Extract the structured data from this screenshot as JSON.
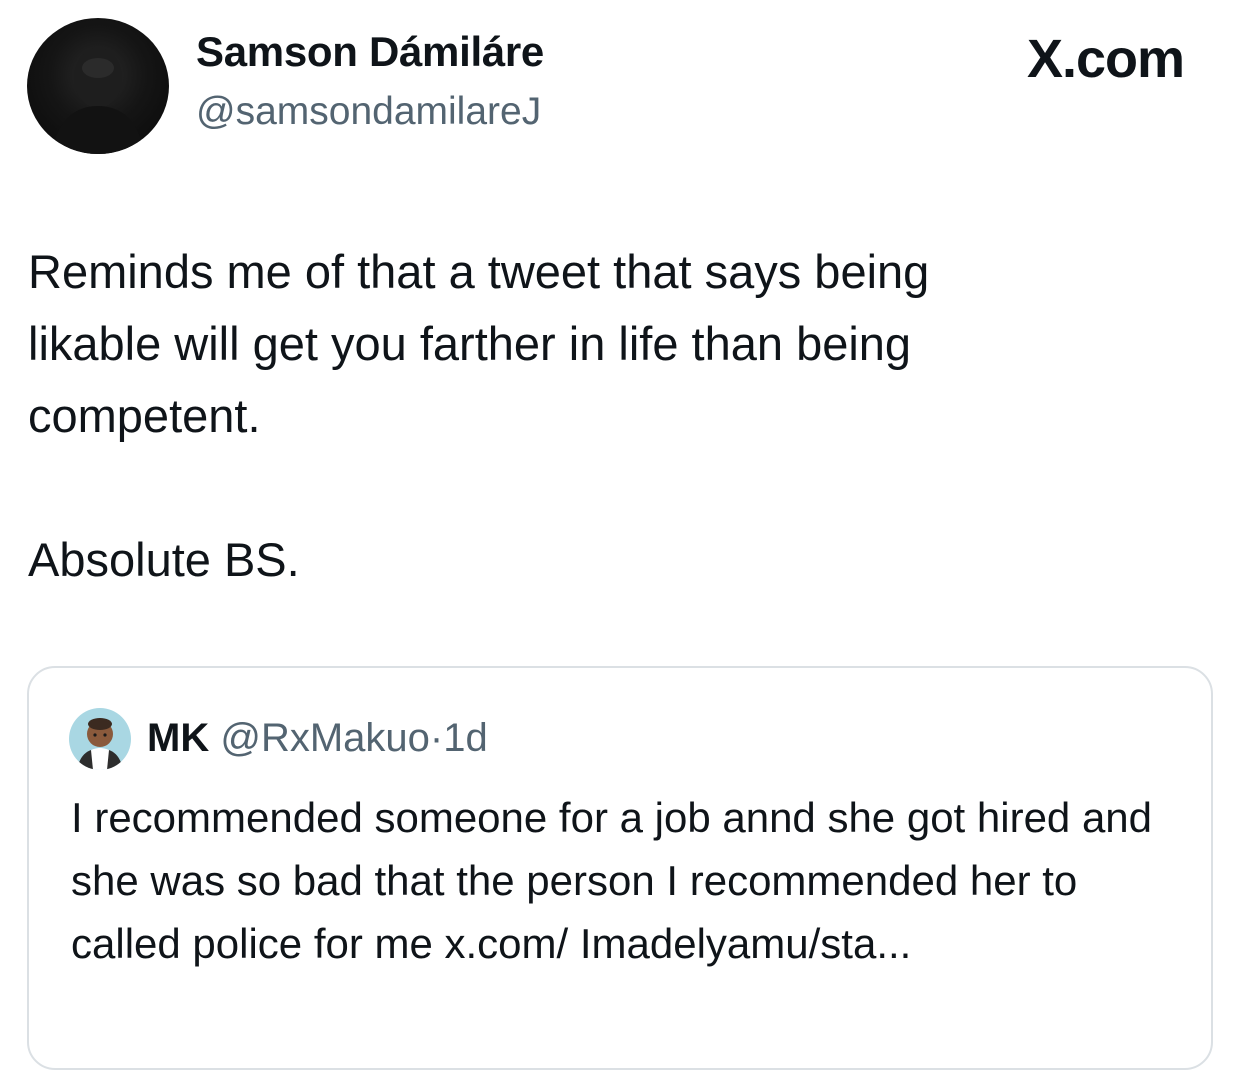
{
  "author": {
    "name": "Samson Dámiláre",
    "handle": "@samsondamilareJ"
  },
  "brand": "X.com",
  "tweet": {
    "text": "Reminds me of that a tweet that says being\nlikable will get you farther in life than being\ncompetent.\n\nAbsolute BS."
  },
  "quote": {
    "name": "MK",
    "handle": "@RxMakuo",
    "separator": "·",
    "time": "1d",
    "text": "I recommended someone for a job annd she got hired and she was so bad that the person I recommended her to called police for me x.com/ Imadelyamu/sta..."
  },
  "colors": {
    "text": "#0f1419",
    "secondary": "#536471",
    "border": "#dbe0e4"
  }
}
